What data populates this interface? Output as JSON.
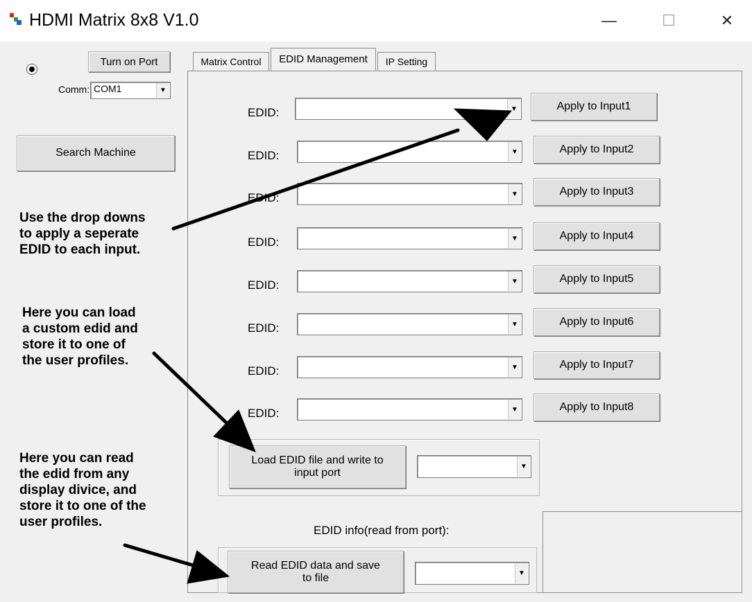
{
  "window": {
    "title": "HDMI Matrix 8x8 V1.0",
    "minimize": "—",
    "maximize": "☐",
    "close": "✕"
  },
  "left": {
    "turn_on_port": "Turn on Port",
    "comm_label": "Comm:",
    "comm_value": "COM1",
    "search_machine": "Search Machine"
  },
  "tabs": [
    {
      "label": "Matrix Control"
    },
    {
      "label": "EDID Management"
    },
    {
      "label": "IP Setting"
    }
  ],
  "edid_rows": [
    {
      "label": "EDID:",
      "button": "Apply to Input1"
    },
    {
      "label": "EDID:",
      "button": "Apply to Input2"
    },
    {
      "label": "EDID:",
      "button": "Apply to Input3"
    },
    {
      "label": "EDID:",
      "button": "Apply to Input4"
    },
    {
      "label": "EDID:",
      "button": "Apply to Input5"
    },
    {
      "label": "EDID:",
      "button": "Apply to Input6"
    },
    {
      "label": "EDID:",
      "button": "Apply to Input7"
    },
    {
      "label": "EDID:",
      "button": "Apply to Input8"
    }
  ],
  "load": {
    "line1": "Load EDID file and write to",
    "line2": "input port"
  },
  "edid_info_label": "EDID info(read from port):",
  "read": {
    "line1": "Read EDID data and save",
    "line2": "to file"
  },
  "annotations": {
    "a1": [
      "Use the drop downs",
      "to apply a seperate",
      "EDID to each input."
    ],
    "a2": [
      "Here you can load",
      "a custom edid and",
      "store it to one of",
      "the user profiles."
    ],
    "a3": [
      "Here you can read",
      "the edid from any",
      "display divice, and",
      "store it to one of the",
      "user profiles."
    ]
  }
}
